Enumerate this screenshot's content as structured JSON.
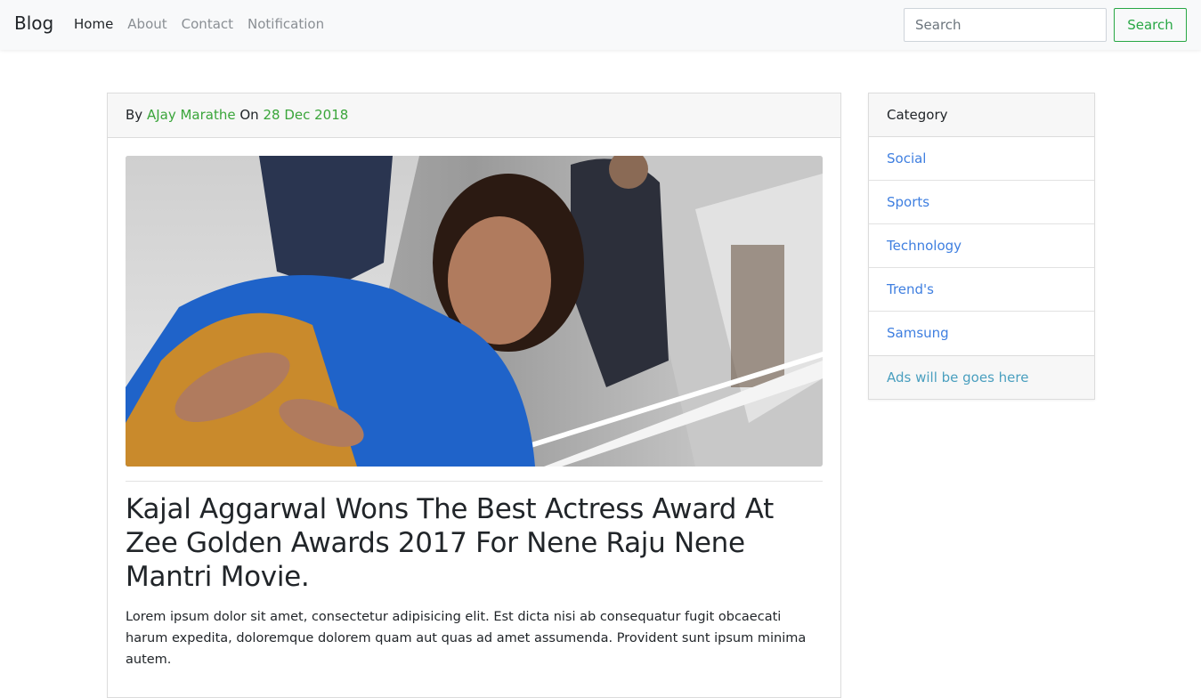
{
  "navbar": {
    "brand": "Blog",
    "links": [
      {
        "label": "Home",
        "active": true
      },
      {
        "label": "About",
        "active": false
      },
      {
        "label": "Contact",
        "active": false
      },
      {
        "label": "Notification",
        "active": false
      }
    ],
    "search_placeholder": "Search",
    "search_button": "Search"
  },
  "post": {
    "by_label": "By",
    "author": "AJay Marathe",
    "on_label": "On",
    "date": "28 Dec 2018",
    "title": "Kajal Aggarwal Wons The Best Actress Award At Zee Golden Awards 2017 For Nene Raju Nene Mantri Movie.",
    "text": "Lorem ipsum dolor sit amet, consectetur adipisicing elit. Est dicta nisi ab consequatur fugit obcaecati harum expedita, doloremque dolorem quam aut quas ad amet assumenda. Provident sunt ipsum minima autem."
  },
  "sidebar": {
    "header": "Category",
    "items": [
      {
        "label": "Social"
      },
      {
        "label": "Sports"
      },
      {
        "label": "Technology"
      },
      {
        "label": "Trend's"
      },
      {
        "label": "Samsung"
      }
    ],
    "footer": "Ads will be goes here"
  },
  "colors": {
    "accent_green": "#28a745",
    "link_blue": "#3f7fe0",
    "ad_text": "#4a9fbf"
  }
}
